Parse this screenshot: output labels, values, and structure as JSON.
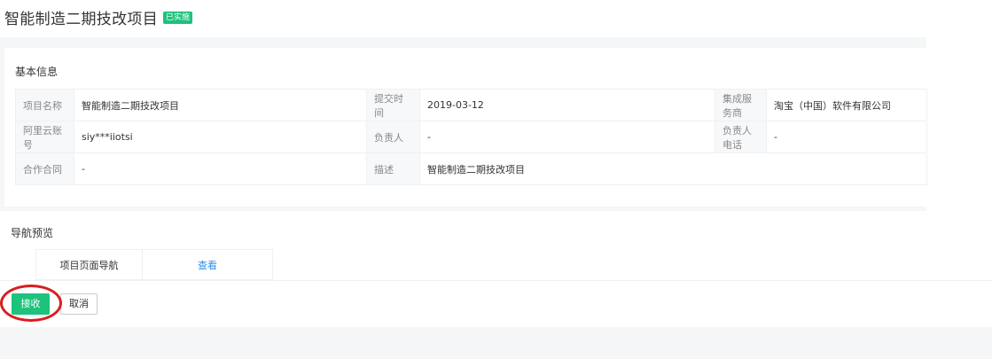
{
  "header": {
    "title": "智能制造二期技改项目",
    "status_badge": "已实施"
  },
  "basic_info": {
    "section_title": "基本信息",
    "rows": [
      [
        {
          "label": "项目名称",
          "value": "智能制造二期技改项目"
        },
        {
          "label": "提交时间",
          "value": "2019-03-12"
        },
        {
          "label": "集成服务商",
          "value": "淘宝（中国）软件有限公司"
        }
      ],
      [
        {
          "label": "阿里云账号",
          "value": "siy***iiotsi"
        },
        {
          "label": "负责人",
          "value": "-"
        },
        {
          "label": "负责人电话",
          "value": "-"
        }
      ],
      [
        {
          "label": "合作合同",
          "value": "-"
        },
        {
          "label": "描述",
          "value": "智能制造二期技改项目"
        }
      ]
    ]
  },
  "nav_preview": {
    "section_title": "导航预览",
    "item_name": "项目页面导航",
    "link_label": "查看"
  },
  "actions": {
    "accept_label": "接收",
    "cancel_label": "取消"
  },
  "colors": {
    "accent_green": "#1dc27c",
    "link_blue": "#2d8cf0",
    "annotation_red": "#d81e1e"
  }
}
